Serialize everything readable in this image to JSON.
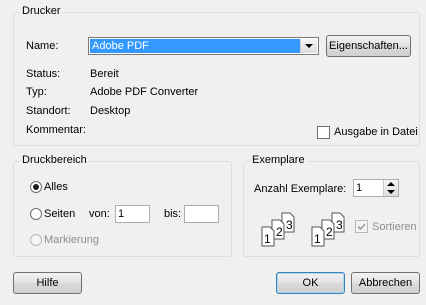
{
  "printer": {
    "legend": "Drucker",
    "name_label": "Name:",
    "name_value": "Adobe PDF",
    "properties_label": "Eigenschaften...",
    "status_label": "Status:",
    "status_value": "Bereit",
    "type_label": "Typ:",
    "type_value": "Adobe PDF Converter",
    "location_label": "Standort:",
    "location_value": "Desktop",
    "comment_label": "Kommentar:",
    "print_to_file_label": "Ausgabe in Datei"
  },
  "range": {
    "legend": "Druckbereich",
    "all_label": "Alles",
    "pages_label": "Seiten",
    "from_label": "von:",
    "from_value": "1",
    "to_label": "bis:",
    "to_value": "",
    "selection_label": "Markierung"
  },
  "copies": {
    "legend": "Exemplare",
    "count_label": "Anzahl Exemplare:",
    "count_value": "1",
    "collate_label": "Sortieren",
    "collate_digits": [
      "1",
      "2",
      "3"
    ]
  },
  "buttons": {
    "help": "Hilfe",
    "ok": "OK",
    "cancel": "Abbrechen"
  },
  "colors": {
    "selection": "#3399ff",
    "group_border": "#d5dfe5",
    "default_button_border": "#3c7fb1"
  }
}
